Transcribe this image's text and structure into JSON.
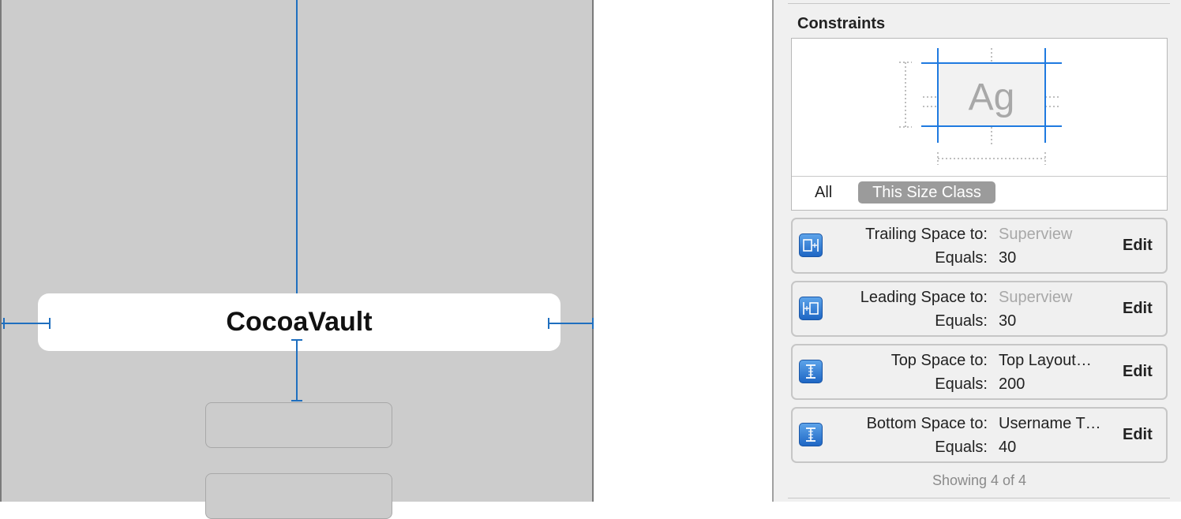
{
  "canvas": {
    "label_text": "CocoaVault"
  },
  "inspector": {
    "section_title": "Constraints",
    "diagram": {
      "preview_text": "Ag",
      "tab_all": "All",
      "tab_size_class": "This Size Class"
    },
    "constraints": [
      {
        "key1": "Trailing Space to:",
        "value1": "Superview",
        "value1_muted": true,
        "key2": "Equals:",
        "value2": "30",
        "edit": "Edit",
        "icon": "trailing-space-icon"
      },
      {
        "key1": "Leading Space to:",
        "value1": "Superview",
        "value1_muted": true,
        "key2": "Equals:",
        "value2": "30",
        "edit": "Edit",
        "icon": "leading-space-icon"
      },
      {
        "key1": "Top Space to:",
        "value1": "Top Layout…",
        "value1_muted": false,
        "key2": "Equals:",
        "value2": "200",
        "edit": "Edit",
        "icon": "vertical-space-icon"
      },
      {
        "key1": "Bottom Space to:",
        "value1": "Username T…",
        "value1_muted": false,
        "key2": "Equals:",
        "value2": "40",
        "edit": "Edit",
        "icon": "vertical-space-icon"
      }
    ],
    "showing_text": "Showing 4 of 4"
  },
  "colors": {
    "constraint_blue": "#1f6fbf",
    "canvas_gray": "#cccccc",
    "inspector_bg": "#f0f0f0"
  }
}
